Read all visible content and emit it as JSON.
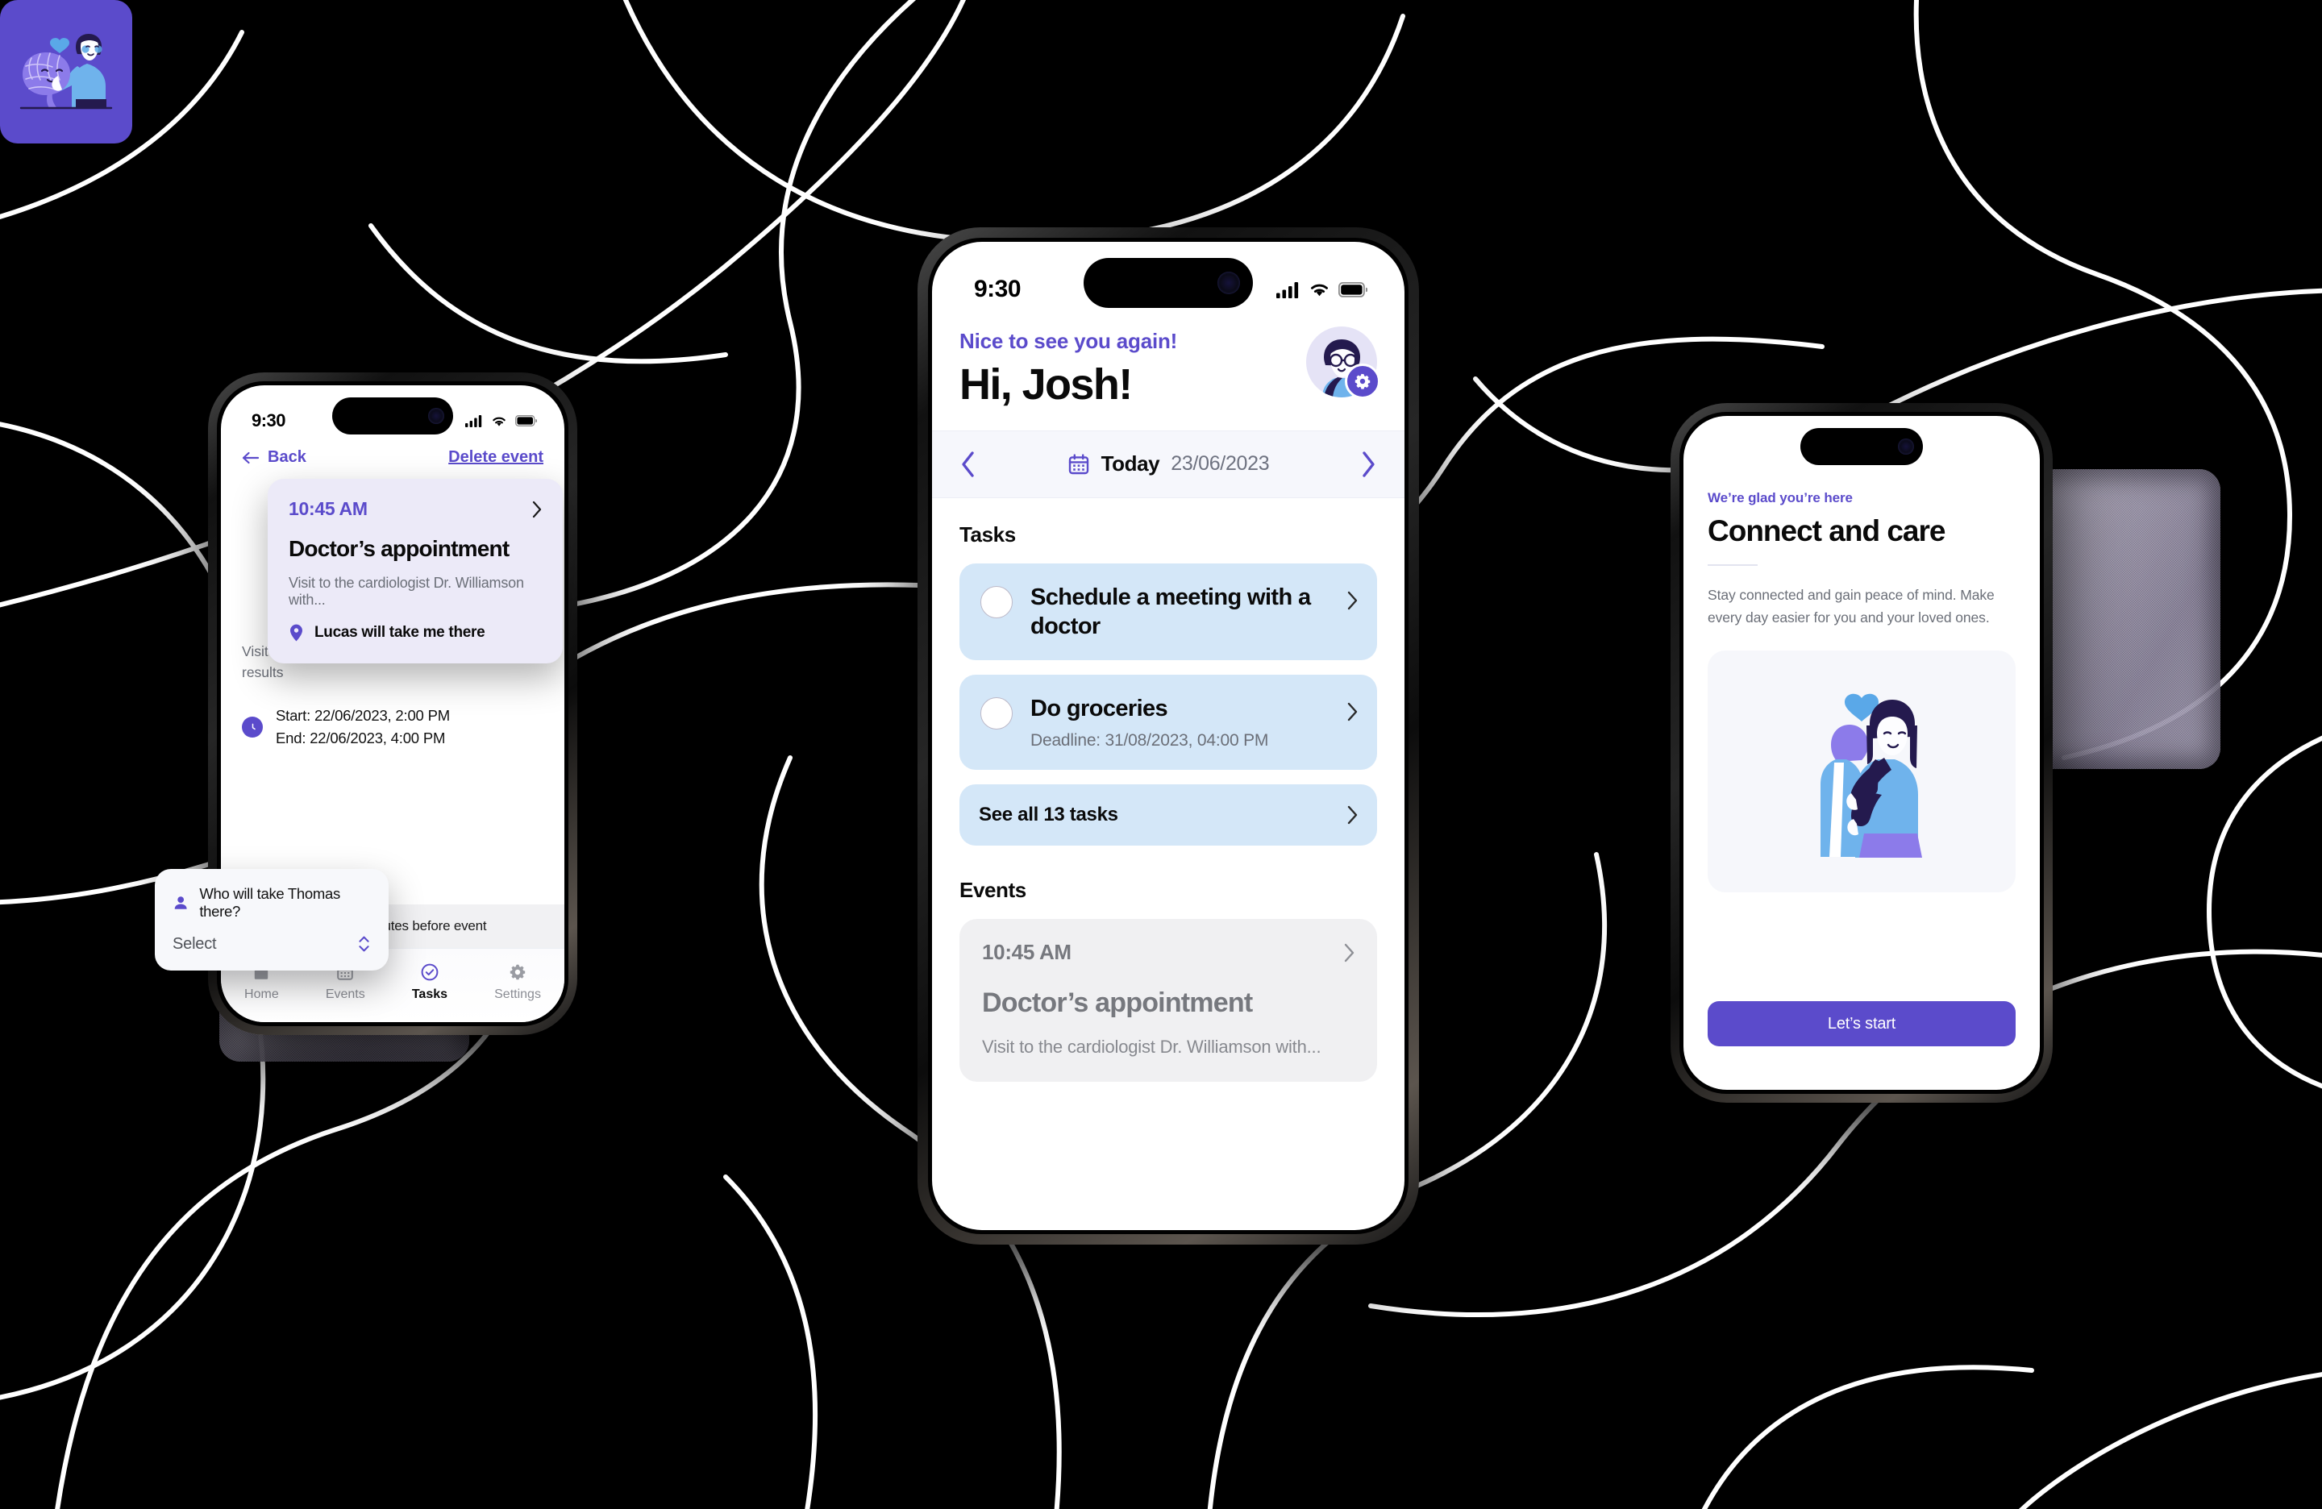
{
  "background": {
    "color": "#000000",
    "line_color": "#ffffff",
    "style": "organic-flowing-curves"
  },
  "theme": {
    "accent": "#5b4bcb",
    "task_card_bg": "#d4e7f8",
    "event_card_bg": "#f0f0f2",
    "floating_card_bg": "#eceaf8",
    "muted_text": "#6b6f78"
  },
  "phone_center": {
    "status": {
      "time": "9:30",
      "cellular_icon": "signal-bars",
      "wifi_icon": "wifi",
      "battery_icon": "battery-full"
    },
    "greeting": "Nice to see you again!",
    "name_heading": "Hi, Josh!",
    "avatar": {
      "name": "user-avatar",
      "badge_icon": "gear-icon"
    },
    "datebar": {
      "prev_icon": "chevron-left-icon",
      "calendar_icon": "calendar-icon",
      "label": "Today",
      "date": "23/06/2023",
      "next_icon": "chevron-right-icon"
    },
    "tasks_section_title": "Tasks",
    "tasks": [
      {
        "title": "Schedule a meeting with a doctor",
        "subtitle": "",
        "checked": false
      },
      {
        "title": "Do groceries",
        "subtitle": "Deadline: 31/08/2023, 04:00 PM",
        "checked": false
      }
    ],
    "see_all_label": "See all 13 tasks",
    "events_section_title": "Events",
    "events": [
      {
        "time": "10:45 AM",
        "title": "Doctor’s appointment",
        "description": "Visit to the cardiologist Dr. Williamson with..."
      }
    ]
  },
  "phone_left": {
    "status": {
      "time": "9:30",
      "cellular_icon": "signal-bars",
      "wifi_icon": "wifi",
      "battery_icon": "battery-full"
    },
    "nav": {
      "back_label": "Back",
      "back_icon": "arrow-left-icon",
      "delete_label": "Delete event"
    },
    "description": "Visit to the cardiologist Dr. Williamson with test results",
    "times": {
      "clock_icon": "clock-icon",
      "start": "Start: 22/06/2023, 2:00 PM",
      "end": "End: 22/06/2023, 4:00 PM"
    },
    "reminder": {
      "icon": "bell-icon",
      "label": "Remind me 15 minutes before event"
    },
    "tabbar": [
      {
        "label": "Home",
        "icon": "home-icon",
        "active": false
      },
      {
        "label": "Events",
        "icon": "calendar-icon",
        "active": false
      },
      {
        "label": "Tasks",
        "icon": "check-circle-icon",
        "active": true
      },
      {
        "label": "Settings",
        "icon": "gear-icon",
        "active": false
      }
    ]
  },
  "phone_right": {
    "eyebrow": "We’re glad you’re here",
    "title": "Connect and care",
    "body": "Stay connected and gain peace of mind. Make every day easier for you and your loved ones.",
    "illustration": "family-hug-illustration",
    "cta_label": "Let’s start"
  },
  "floating_cards": {
    "event": {
      "time": "10:45 AM",
      "chevron_icon": "chevron-right-icon",
      "title": "Doctor’s appointment",
      "description": "Visit to the cardiologist Dr. Williamson with...",
      "location_icon": "map-pin-icon",
      "location_label": "Lucas will take me there"
    },
    "select": {
      "person_icon": "person-icon",
      "question": "Who will take Thomas there?",
      "value": "Select",
      "stepper_icon": "chevron-up-down-icon"
    },
    "brain": {
      "illustration": "brain-care-illustration",
      "bg": "#5b4bcb"
    }
  }
}
